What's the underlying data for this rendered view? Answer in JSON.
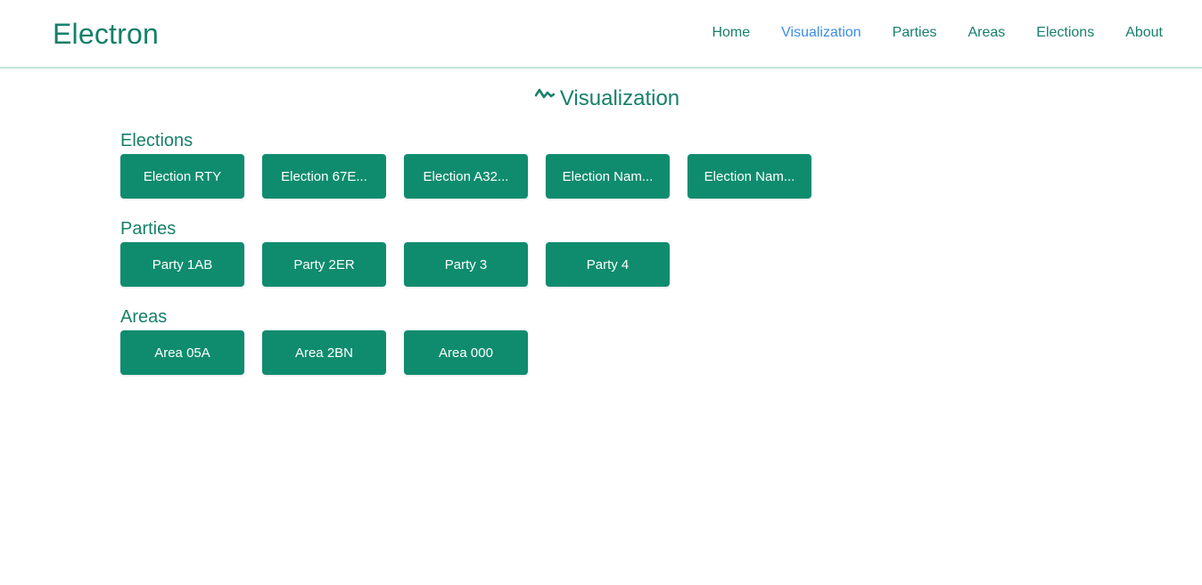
{
  "brand": "Electron",
  "nav": {
    "home": "Home",
    "visualization": "Visualization",
    "parties": "Parties",
    "areas": "Areas",
    "elections": "Elections",
    "about": "About"
  },
  "page": {
    "title": "Visualization",
    "title_icon": "chart-line-icon"
  },
  "sections": {
    "elections": {
      "heading": "Elections",
      "items": [
        "Election RTY",
        "Election 67E...",
        "Election A32...",
        "Election Nam...",
        "Election Nam..."
      ]
    },
    "parties": {
      "heading": "Parties",
      "items": [
        "Party 1AB",
        "Party 2ER",
        "Party 3",
        "Party 4"
      ]
    },
    "areas": {
      "heading": "Areas",
      "items": [
        "Area 05A",
        "Area 2BN",
        "Area 000"
      ]
    }
  },
  "colors": {
    "primary": "#16806a",
    "button_bg": "#0f8c6e",
    "active_link": "#3a8ee6",
    "nav_border": "#c3e6da"
  }
}
